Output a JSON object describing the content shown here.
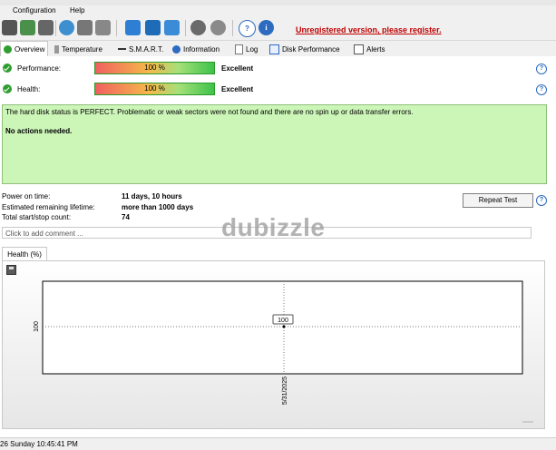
{
  "menu": {
    "configuration": "Configuration",
    "help": "Help"
  },
  "toolbar": {
    "unregistered": "Unregistered version, please register."
  },
  "tabs": [
    {
      "label": "Overview",
      "icon": "checkmark-icon"
    },
    {
      "label": "Temperature",
      "icon": "thermometer-icon"
    },
    {
      "label": "S.M.A.R.T.",
      "icon": "smart-icon"
    },
    {
      "label": "Information",
      "icon": "info-icon"
    },
    {
      "label": "Log",
      "icon": "log-icon"
    },
    {
      "label": "Disk Performance",
      "icon": "performance-icon"
    },
    {
      "label": "Alerts",
      "icon": "alert-icon"
    }
  ],
  "overview": {
    "performance": {
      "label": "Performance:",
      "percent": "100 %",
      "value": 100,
      "rating": "Excellent"
    },
    "health": {
      "label": "Health:",
      "percent": "100 %",
      "value": 100,
      "rating": "Excellent"
    },
    "status_message": "The hard disk status is PERFECT. Problematic or weak sectors were not found and there are no spin up or data transfer errors.",
    "actions": "No actions needed.",
    "power_on_label": "Power on time:",
    "power_on_value": "11 days, 10 hours",
    "lifetime_label": "Estimated remaining lifetime:",
    "lifetime_value": "more than 1000 days",
    "startstop_label": "Total start/stop count:",
    "startstop_value": "74",
    "repeat_button": "Repeat Test",
    "comment_placeholder": "Click to add comment ..."
  },
  "chart_tab": "Health (%)",
  "chart_data": {
    "type": "line",
    "title": "",
    "xlabel": "",
    "ylabel": "",
    "x": [
      "5/31/2025"
    ],
    "series": [
      {
        "values": [
          100
        ]
      }
    ],
    "ytick": "100",
    "data_label": "100"
  },
  "statusbar": {
    "text": "26 Sunday 10:45:41 PM"
  },
  "watermark": "dubizzle",
  "colors": {
    "unregistered": "#c00000",
    "status_bg": "#ccf5b8",
    "ok": "#2e9e2e"
  }
}
